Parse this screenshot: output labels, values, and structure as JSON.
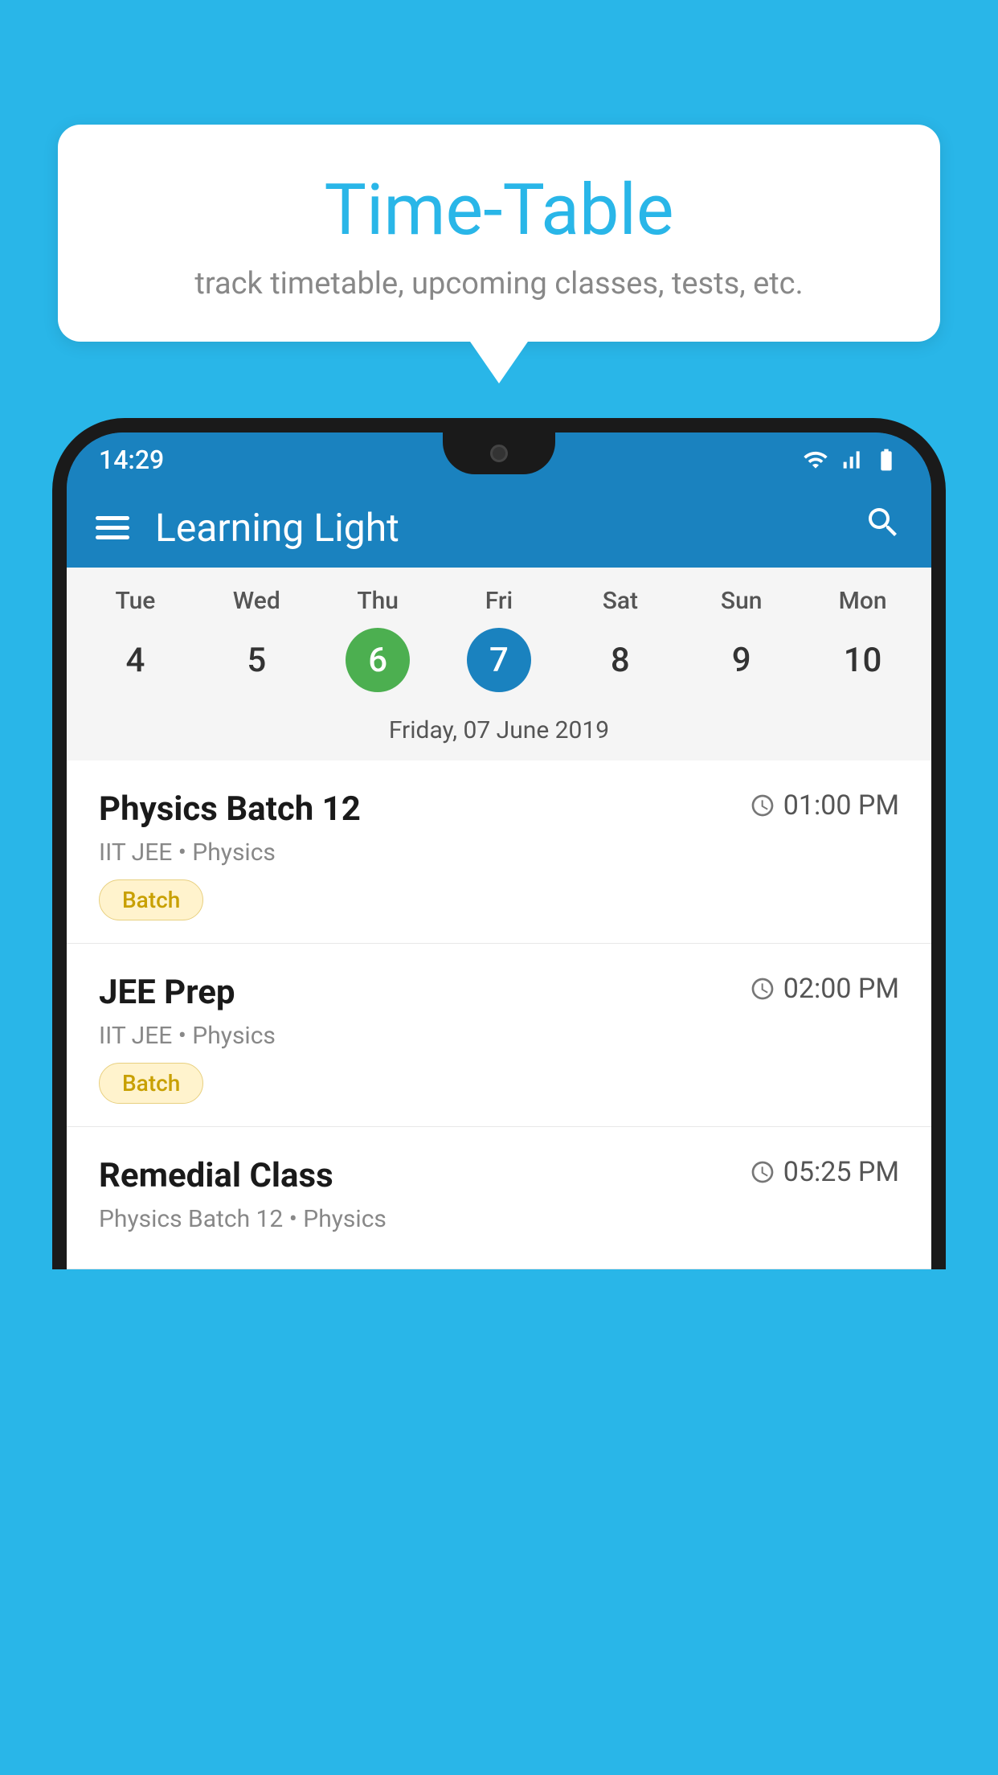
{
  "background": {
    "color": "#29b6e8"
  },
  "bubble": {
    "title": "Time-Table",
    "subtitle": "track timetable, upcoming classes, tests, etc."
  },
  "status_bar": {
    "time": "14:29"
  },
  "app_header": {
    "title": "Learning Light"
  },
  "calendar": {
    "days": [
      "Tue",
      "Wed",
      "Thu",
      "Fri",
      "Sat",
      "Sun",
      "Mon"
    ],
    "dates": [
      "4",
      "5",
      "6",
      "7",
      "8",
      "9",
      "10"
    ],
    "today_index": 2,
    "selected_index": 3,
    "selected_label": "Friday, 07 June 2019"
  },
  "schedule": [
    {
      "title": "Physics Batch 12",
      "time": "01:00 PM",
      "subtitle": "IIT JEE • Physics",
      "tag": "Batch"
    },
    {
      "title": "JEE Prep",
      "time": "02:00 PM",
      "subtitle": "IIT JEE • Physics",
      "tag": "Batch"
    },
    {
      "title": "Remedial Class",
      "time": "05:25 PM",
      "subtitle": "Physics Batch 12 • Physics",
      "tag": ""
    }
  ],
  "icons": {
    "menu": "menu-icon",
    "search": "🔍",
    "clock": "⏱"
  }
}
